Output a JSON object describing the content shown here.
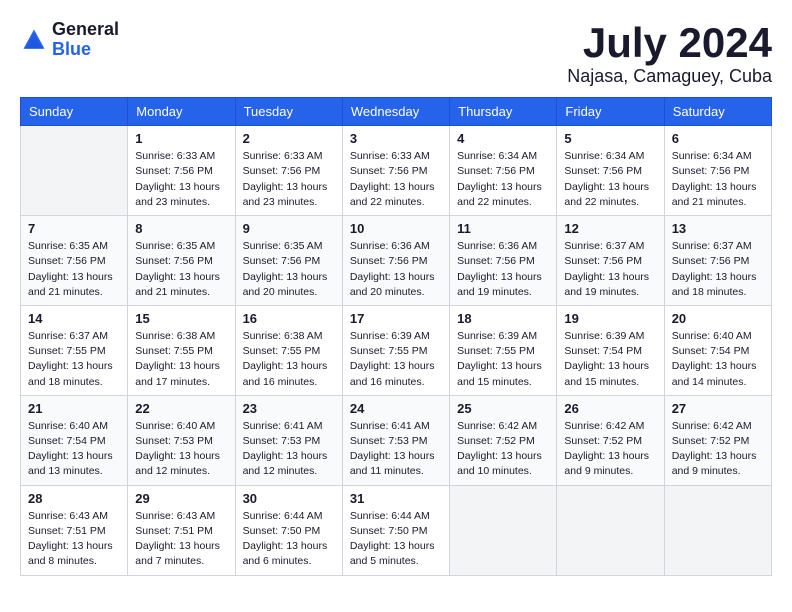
{
  "logo": {
    "general": "General",
    "blue": "Blue"
  },
  "title": "July 2024",
  "location": "Najasa, Camaguey, Cuba",
  "days_header": [
    "Sunday",
    "Monday",
    "Tuesday",
    "Wednesday",
    "Thursday",
    "Friday",
    "Saturday"
  ],
  "weeks": [
    [
      {
        "day": "",
        "info": ""
      },
      {
        "day": "1",
        "info": "Sunrise: 6:33 AM\nSunset: 7:56 PM\nDaylight: 13 hours and 23 minutes."
      },
      {
        "day": "2",
        "info": "Sunrise: 6:33 AM\nSunset: 7:56 PM\nDaylight: 13 hours and 23 minutes."
      },
      {
        "day": "3",
        "info": "Sunrise: 6:33 AM\nSunset: 7:56 PM\nDaylight: 13 hours and 22 minutes."
      },
      {
        "day": "4",
        "info": "Sunrise: 6:34 AM\nSunset: 7:56 PM\nDaylight: 13 hours and 22 minutes."
      },
      {
        "day": "5",
        "info": "Sunrise: 6:34 AM\nSunset: 7:56 PM\nDaylight: 13 hours and 22 minutes."
      },
      {
        "day": "6",
        "info": "Sunrise: 6:34 AM\nSunset: 7:56 PM\nDaylight: 13 hours and 21 minutes."
      }
    ],
    [
      {
        "day": "7",
        "info": "Sunrise: 6:35 AM\nSunset: 7:56 PM\nDaylight: 13 hours and 21 minutes."
      },
      {
        "day": "8",
        "info": "Sunrise: 6:35 AM\nSunset: 7:56 PM\nDaylight: 13 hours and 21 minutes."
      },
      {
        "day": "9",
        "info": "Sunrise: 6:35 AM\nSunset: 7:56 PM\nDaylight: 13 hours and 20 minutes."
      },
      {
        "day": "10",
        "info": "Sunrise: 6:36 AM\nSunset: 7:56 PM\nDaylight: 13 hours and 20 minutes."
      },
      {
        "day": "11",
        "info": "Sunrise: 6:36 AM\nSunset: 7:56 PM\nDaylight: 13 hours and 19 minutes."
      },
      {
        "day": "12",
        "info": "Sunrise: 6:37 AM\nSunset: 7:56 PM\nDaylight: 13 hours and 19 minutes."
      },
      {
        "day": "13",
        "info": "Sunrise: 6:37 AM\nSunset: 7:56 PM\nDaylight: 13 hours and 18 minutes."
      }
    ],
    [
      {
        "day": "14",
        "info": "Sunrise: 6:37 AM\nSunset: 7:55 PM\nDaylight: 13 hours and 18 minutes."
      },
      {
        "day": "15",
        "info": "Sunrise: 6:38 AM\nSunset: 7:55 PM\nDaylight: 13 hours and 17 minutes."
      },
      {
        "day": "16",
        "info": "Sunrise: 6:38 AM\nSunset: 7:55 PM\nDaylight: 13 hours and 16 minutes."
      },
      {
        "day": "17",
        "info": "Sunrise: 6:39 AM\nSunset: 7:55 PM\nDaylight: 13 hours and 16 minutes."
      },
      {
        "day": "18",
        "info": "Sunrise: 6:39 AM\nSunset: 7:55 PM\nDaylight: 13 hours and 15 minutes."
      },
      {
        "day": "19",
        "info": "Sunrise: 6:39 AM\nSunset: 7:54 PM\nDaylight: 13 hours and 15 minutes."
      },
      {
        "day": "20",
        "info": "Sunrise: 6:40 AM\nSunset: 7:54 PM\nDaylight: 13 hours and 14 minutes."
      }
    ],
    [
      {
        "day": "21",
        "info": "Sunrise: 6:40 AM\nSunset: 7:54 PM\nDaylight: 13 hours and 13 minutes."
      },
      {
        "day": "22",
        "info": "Sunrise: 6:40 AM\nSunset: 7:53 PM\nDaylight: 13 hours and 12 minutes."
      },
      {
        "day": "23",
        "info": "Sunrise: 6:41 AM\nSunset: 7:53 PM\nDaylight: 13 hours and 12 minutes."
      },
      {
        "day": "24",
        "info": "Sunrise: 6:41 AM\nSunset: 7:53 PM\nDaylight: 13 hours and 11 minutes."
      },
      {
        "day": "25",
        "info": "Sunrise: 6:42 AM\nSunset: 7:52 PM\nDaylight: 13 hours and 10 minutes."
      },
      {
        "day": "26",
        "info": "Sunrise: 6:42 AM\nSunset: 7:52 PM\nDaylight: 13 hours and 9 minutes."
      },
      {
        "day": "27",
        "info": "Sunrise: 6:42 AM\nSunset: 7:52 PM\nDaylight: 13 hours and 9 minutes."
      }
    ],
    [
      {
        "day": "28",
        "info": "Sunrise: 6:43 AM\nSunset: 7:51 PM\nDaylight: 13 hours and 8 minutes."
      },
      {
        "day": "29",
        "info": "Sunrise: 6:43 AM\nSunset: 7:51 PM\nDaylight: 13 hours and 7 minutes."
      },
      {
        "day": "30",
        "info": "Sunrise: 6:44 AM\nSunset: 7:50 PM\nDaylight: 13 hours and 6 minutes."
      },
      {
        "day": "31",
        "info": "Sunrise: 6:44 AM\nSunset: 7:50 PM\nDaylight: 13 hours and 5 minutes."
      },
      {
        "day": "",
        "info": ""
      },
      {
        "day": "",
        "info": ""
      },
      {
        "day": "",
        "info": ""
      }
    ]
  ]
}
